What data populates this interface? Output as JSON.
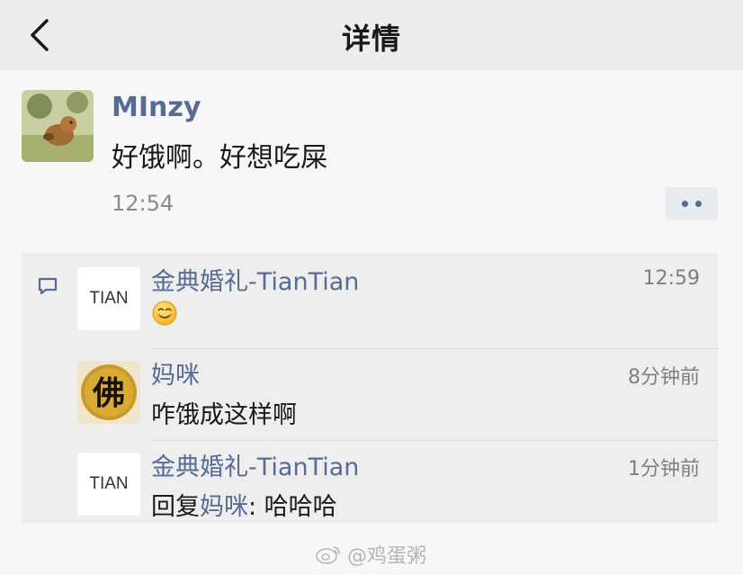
{
  "nav": {
    "title": "详情"
  },
  "post": {
    "author": "MInzy",
    "text": "好饿啊。好想吃屎",
    "time": "12:54"
  },
  "comments": [
    {
      "name": "金典婚礼-TianTian",
      "avatar_text": "TIAN",
      "time": "12:59",
      "emoji": "smiling-face-emoji"
    },
    {
      "name": "妈咪",
      "avatar_text": "佛",
      "time": "8分钟前",
      "text": "咋饿成这样啊"
    },
    {
      "name": "金典婚礼-TianTian",
      "avatar_text": "TIAN",
      "time": "1分钟前",
      "reply_prefix": "回复",
      "reply_to": "妈咪",
      "reply_text": ": 哈哈哈"
    }
  ],
  "watermark": "@鸡蛋粥",
  "colors": {
    "link": "#576b95",
    "header_bg": "#ededed",
    "comment_bg": "#eeeeee"
  }
}
